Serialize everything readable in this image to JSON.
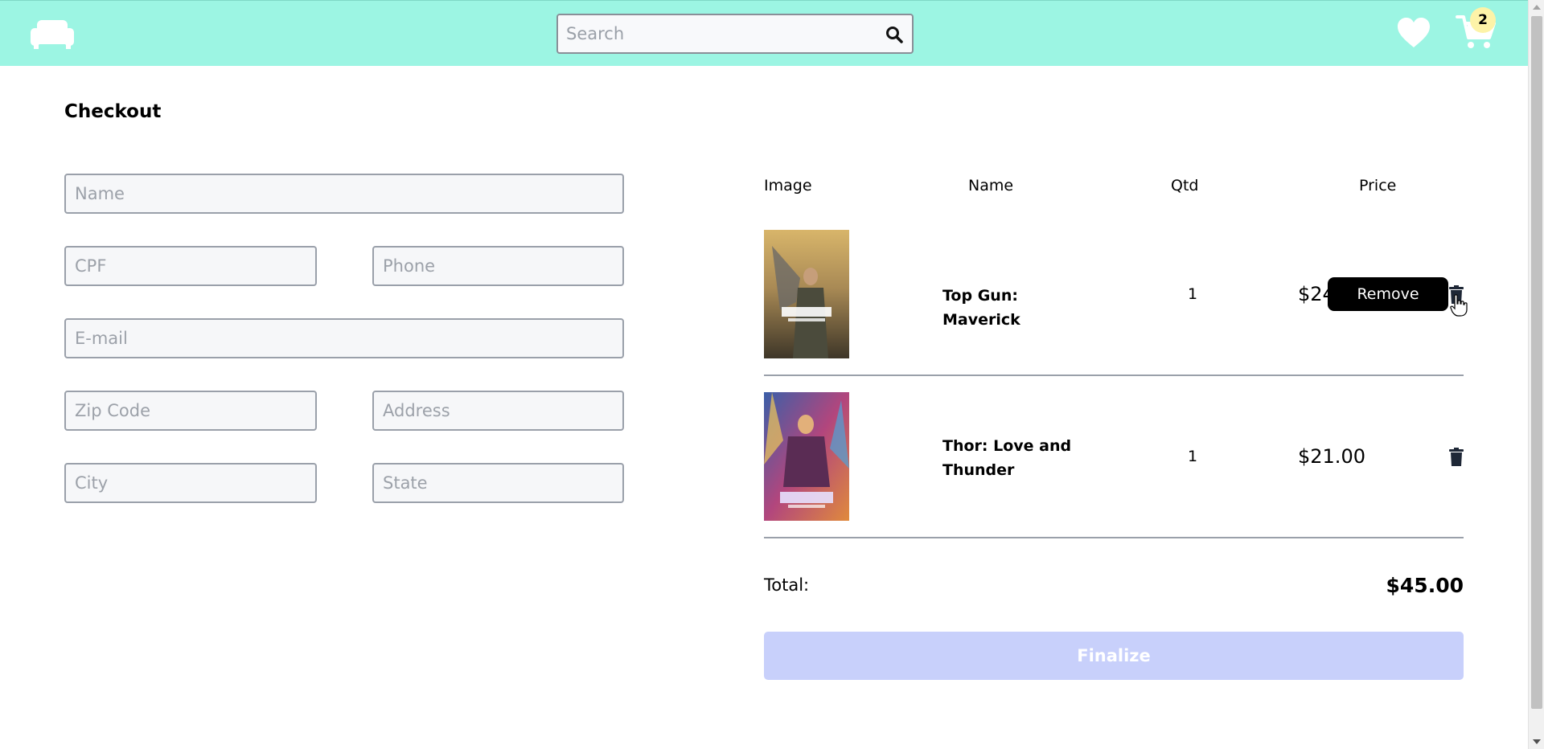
{
  "header": {
    "search_placeholder": "Search",
    "cart_count": "2",
    "icons": [
      "sofa-logo-icon",
      "search-icon",
      "heart-icon",
      "cart-icon"
    ]
  },
  "page_title": "Checkout",
  "form": {
    "name_placeholder": "Name",
    "cpf_placeholder": "CPF",
    "phone_placeholder": "Phone",
    "email_placeholder": "E-mail",
    "zip_placeholder": "Zip Code",
    "address_placeholder": "Address",
    "city_placeholder": "City",
    "state_placeholder": "State"
  },
  "table": {
    "headers": [
      "Image",
      "Name",
      "Qtd",
      "Price"
    ],
    "items": [
      {
        "name": "Top Gun: Maverick",
        "qty": "1",
        "price": "$24"
      },
      {
        "name": "Thor: Love and Thunder",
        "qty": "1",
        "price": "$21.00"
      }
    ]
  },
  "tooltip": "Remove",
  "total": {
    "label": "Total:",
    "value": "$45.00"
  },
  "finalize_label": "Finalize",
  "colors": {
    "header_bg": "#9cf5e3",
    "finalize_bg": "#c8d0fb",
    "badge_bg": "#fdf3a8",
    "trash_icon": "#1e2736"
  }
}
